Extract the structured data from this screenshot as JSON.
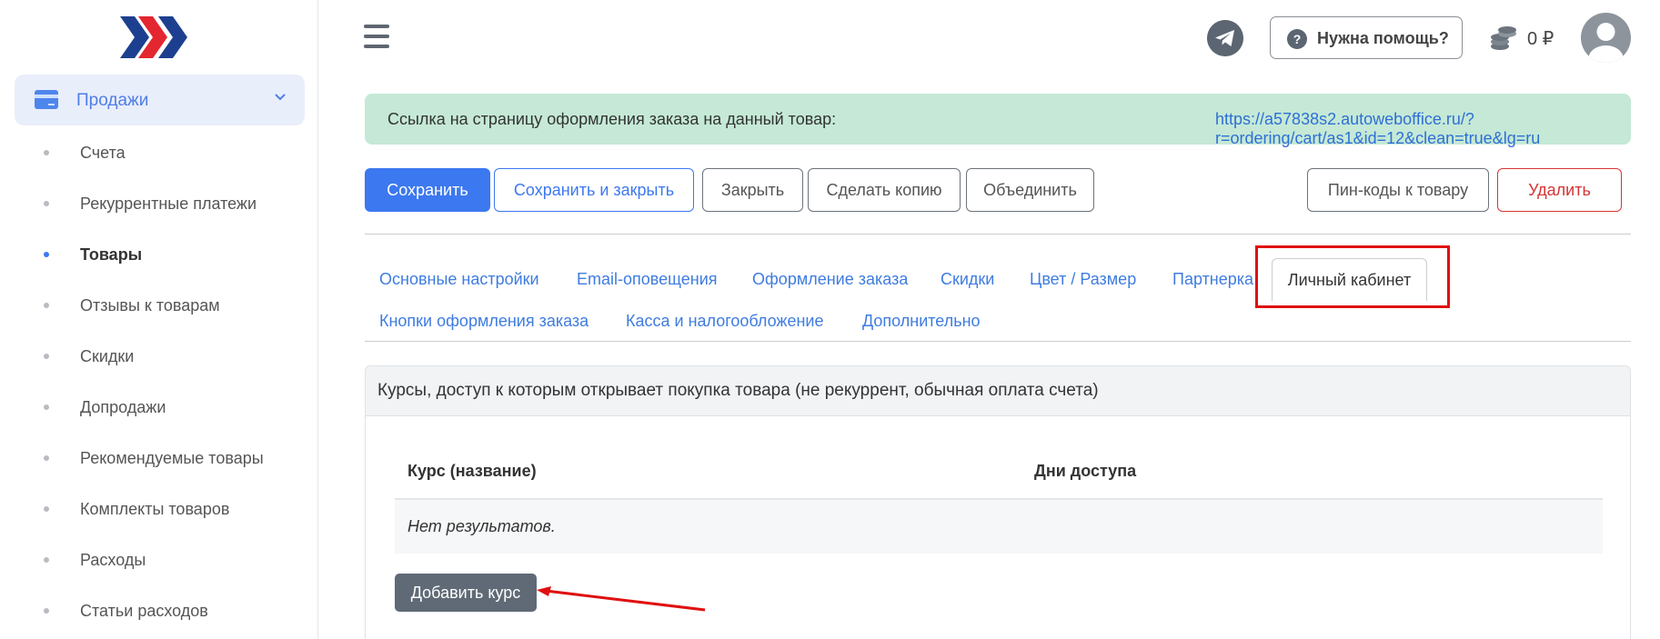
{
  "colors": {
    "accent": "#3c78f0",
    "banner_bg": "#c5e9d6",
    "danger": "#d53434",
    "highlight_frame": "#e01010",
    "sidebar_active_bg": "#e9eefb",
    "add_button_bg": "#5f6a76"
  },
  "sidebar": {
    "section": {
      "label": "Продажи",
      "icon": "credit-card-icon",
      "expanded": true
    },
    "items": [
      {
        "label": "Счета",
        "active": false
      },
      {
        "label": "Рекуррентные платежи",
        "active": false
      },
      {
        "label": "Товары",
        "active": true
      },
      {
        "label": "Отзывы к товарам",
        "active": false
      },
      {
        "label": "Скидки",
        "active": false
      },
      {
        "label": "Допродажи",
        "active": false
      },
      {
        "label": "Рекомендуемые товары",
        "active": false
      },
      {
        "label": "Комплекты товаров",
        "active": false
      },
      {
        "label": "Расходы",
        "active": false
      },
      {
        "label": "Статьи расходов",
        "active": false
      }
    ]
  },
  "topbar": {
    "help_label": "Нужна помощь?",
    "balance": "0 ₽"
  },
  "banner": {
    "label": "Ссылка на страницу оформления заказа на данный товар:",
    "link": "https://a57838s2.autoweboffice.ru/?r=ordering/cart/as1&id=12&clean=true&lg=ru"
  },
  "toolbar": {
    "save": "Сохранить",
    "save_close": "Сохранить и закрыть",
    "close": "Закрыть",
    "copy": "Сделать копию",
    "merge": "Объединить",
    "pincodes": "Пин-коды к товару",
    "delete": "Удалить"
  },
  "tabs": {
    "row1": [
      "Основные настройки",
      "Email-оповещения",
      "Оформление заказа",
      "Скидки",
      "Цвет / Размер",
      "Партнерка"
    ],
    "active": "Личный кабинет",
    "row2": [
      "Кнопки оформления заказа",
      "Касса и налогообложение",
      "Дополнительно"
    ]
  },
  "panel": {
    "title": "Курсы, доступ к которым открывает покупка товара (не рекуррент, обычная оплата счета)",
    "columns": [
      "Курс (название)",
      "Дни доступа"
    ],
    "empty_text": "Нет результатов.",
    "add_button": "Добавить курс"
  }
}
